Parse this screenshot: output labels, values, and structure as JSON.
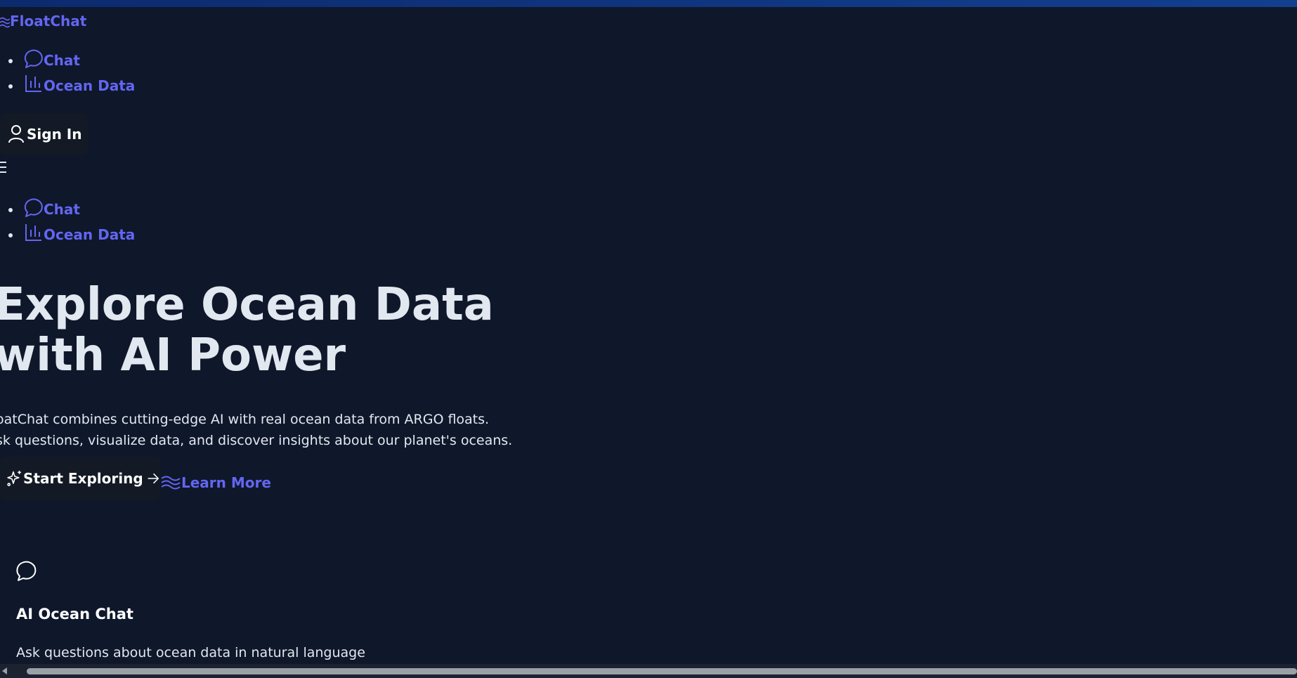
{
  "header": {
    "logo_text": "FloatChat",
    "nav": [
      {
        "label": "Chat",
        "icon": "message-circle-icon"
      },
      {
        "label": "Ocean Data",
        "icon": "bar-chart-icon"
      }
    ],
    "sign_in_label": "Sign In"
  },
  "mobile_nav": [
    {
      "label": "Chat",
      "icon": "message-circle-icon"
    },
    {
      "label": "Ocean Data",
      "icon": "bar-chart-icon"
    }
  ],
  "hero": {
    "title_line1": "Explore Ocean Data",
    "title_line2": "with AI Power",
    "desc_line1": "oatChat combines cutting-edge AI with real ocean data from ARGO floats.",
    "desc_line2": "sk questions, visualize data, and discover insights about our planet's oceans.",
    "primary_cta": "Start Exploring",
    "secondary_cta": "Learn More"
  },
  "features": [
    {
      "icon": "message-circle-icon",
      "title": "AI Ocean Chat",
      "desc": "Ask questions about ocean data in natural language"
    }
  ],
  "colors": {
    "background": "#0f172a",
    "link": "#6366f1",
    "button_bg": "#141a25",
    "text": "#e2e8f0"
  }
}
